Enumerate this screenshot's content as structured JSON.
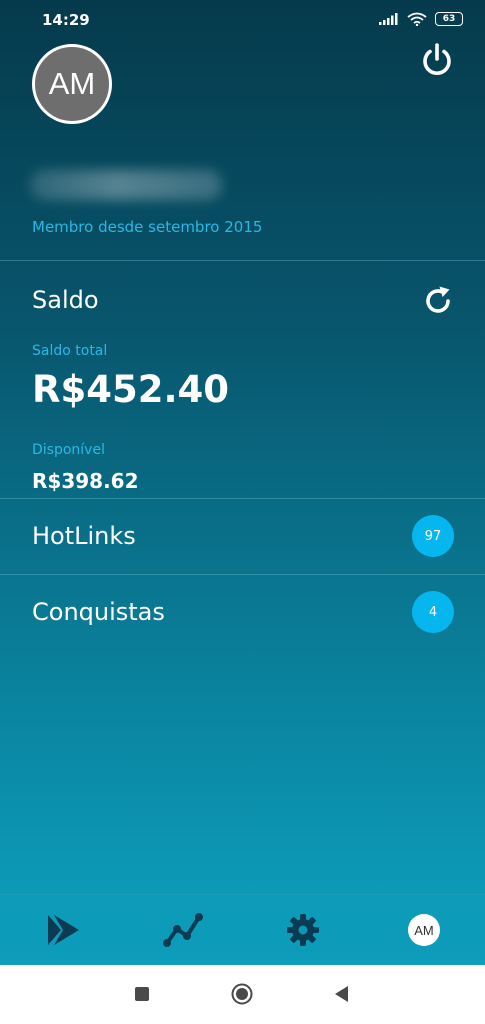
{
  "status_bar": {
    "time": "14:29",
    "battery": "63",
    "icons": [
      "signal-icon",
      "wifi-icon",
      "battery-icon"
    ]
  },
  "profile": {
    "avatar_initials": "AM",
    "member_since": "Membro desde setembro 2015"
  },
  "balance": {
    "title": "Saldo",
    "total_label": "Saldo total",
    "total_value": "R$452.40",
    "available_label": "Disponível",
    "available_value": "R$398.62"
  },
  "rows": [
    {
      "label": "HotLinks",
      "badge": "97"
    },
    {
      "label": "Conquistas",
      "badge": "4"
    }
  ],
  "bottom_nav": {
    "items": [
      "play-logo-icon",
      "chart-trend-icon",
      "settings-gear-icon",
      "profile-avatar"
    ],
    "avatar_initials": "AM"
  },
  "system_nav": [
    "recents-button",
    "home-button",
    "back-button"
  ],
  "colors": {
    "accent_text": "#29b8e5",
    "badge": "#06b7ef",
    "bg_top": "#053a4c",
    "bg_bottom": "#0c9fbc"
  }
}
